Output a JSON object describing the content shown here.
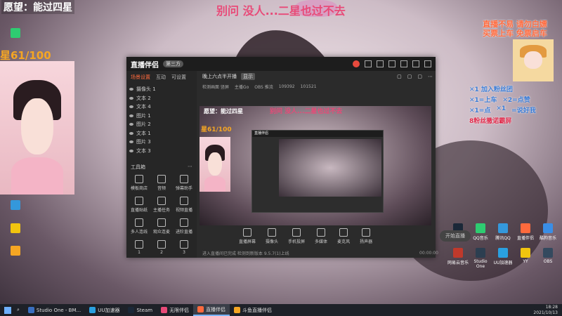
{
  "overlay": {
    "wish": "愿望：能过四星",
    "star_progress": "星61/100",
    "top_slogan": "别问 没人...二星也过不去",
    "right_title_1": "直播不易 请勿白嫖",
    "right_title_2": "买票上车 免票启车",
    "gifts": [
      "✕1 加入粉丝团",
      "✕1=上车",
      "✕2=点赞",
      "✕1=点",
      "=说好我",
      "✕1",
      "8粉丝撒诺霸屏"
    ]
  },
  "app": {
    "title": "直播伴侣",
    "badge": "第三方",
    "left_tabs": [
      "场景设置",
      "互动",
      "可设置"
    ],
    "sources": [
      "摄像头 1",
      "文本 2",
      "文本 4",
      "图片 1",
      "图片 2",
      "文本 1",
      "图片 3",
      "文本 3"
    ],
    "tools_header": "工具箱",
    "tools": [
      "模板商店",
      "音频",
      "弹幕助手",
      "直播贴纸",
      "主播任务",
      "视频直播",
      "多人连线",
      "观众连麦",
      "进阶直播",
      "1",
      "2",
      "3"
    ],
    "stream_title": "晚上六点半开播",
    "stream_tag": "显示",
    "info": [
      "检测画面 竖屏",
      "主播Go",
      "OBS 推流",
      "109392",
      "101521"
    ],
    "controls": [
      "直播屏幕",
      "摄像头",
      "手机投屏",
      "多媒体",
      "麦克风",
      "扬声器"
    ],
    "start_button": "开始直播",
    "status": "进入直播间已完成 检测到新版本 9.5.7(1)上线",
    "status_right": "00:00:00",
    "inner_title": "直播伴侣"
  },
  "taskbar": {
    "items": [
      {
        "label": "Studio One - BM...",
        "color": "#3a6fc0"
      },
      {
        "label": "UU加速器",
        "color": "#2aa0e0"
      },
      {
        "label": "Steam",
        "color": "#1b2838"
      },
      {
        "label": "无限伴侣",
        "color": "#e84a78"
      },
      {
        "label": "直播伴侣",
        "color": "#ff6a3d"
      },
      {
        "label": "斗鱼直播伴侣",
        "color": "#f5a623"
      }
    ],
    "time": "18:28",
    "date": "2021/10/13"
  },
  "desktop_icons": [
    {
      "label": "Steam",
      "color": "#1b2838"
    },
    {
      "label": "QQ音乐",
      "color": "#2ecc71"
    },
    {
      "label": "腾讯QQ",
      "color": "#3498db"
    },
    {
      "label": "直播伴侣",
      "color": "#ff6a3d"
    },
    {
      "label": "酷狗音乐",
      "color": "#3a8ee6"
    },
    {
      "label": "网易云音乐",
      "color": "#c0392b"
    },
    {
      "label": "Studio One",
      "color": "#2c3e50"
    },
    {
      "label": "UU加速器",
      "color": "#2aa0e0"
    },
    {
      "label": "YY",
      "color": "#f1c40f"
    },
    {
      "label": "OBS",
      "color": "#34495e"
    }
  ]
}
